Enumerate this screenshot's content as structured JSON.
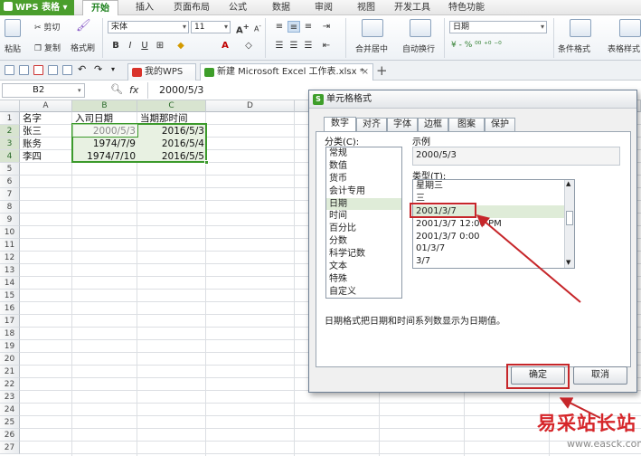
{
  "menu": {
    "app": "WPS 表格",
    "tabs": [
      "开始",
      "插入",
      "页面布局",
      "公式",
      "数据",
      "审阅",
      "视图",
      "开发工具",
      "特色功能"
    ]
  },
  "ribbon": {
    "paste": "粘贴",
    "cut": "剪切",
    "copy": "复制",
    "format_painter": "格式刷",
    "font": "宋体",
    "size": "11",
    "bold": "B",
    "italic": "I",
    "underline": "U",
    "merge": "合并居中",
    "wrap": "自动换行",
    "number_format": "日期",
    "cond_format": "条件格式",
    "table_format": "表格样式",
    "font_color_letter": "A"
  },
  "doc_tabs": [
    "我的WPS",
    "新建 Microsoft Excel 工作表.xlsx *"
  ],
  "formula": {
    "cell": "B2",
    "fx": "fx",
    "value": "2000/5/3"
  },
  "columns": [
    "A",
    "B",
    "C",
    "D"
  ],
  "rows": [
    "1",
    "2",
    "3",
    "4",
    "5",
    "6",
    "7",
    "8",
    "9",
    "10",
    "11",
    "12",
    "13",
    "14",
    "15",
    "16",
    "17",
    "18",
    "19",
    "20",
    "21",
    "22",
    "23",
    "24",
    "25",
    "26",
    "27"
  ],
  "sheet": [
    [
      "名字",
      "入司日期",
      "当期那时间"
    ],
    [
      "张三",
      "2000/5/3",
      "2016/5/3"
    ],
    [
      "账务",
      "1974/7/9",
      "2016/5/4"
    ],
    [
      "李四",
      "1974/7/10",
      "2016/5/5"
    ]
  ],
  "dialog": {
    "title": "单元格格式",
    "tabs": [
      "数字",
      "对齐",
      "字体",
      "边框",
      "图案",
      "保护"
    ],
    "category_label": "分类(C):",
    "categories": [
      "常规",
      "数值",
      "货币",
      "会计专用",
      "日期",
      "时间",
      "百分比",
      "分数",
      "科学记数",
      "文本",
      "特殊",
      "自定义"
    ],
    "sample_label": "示例",
    "sample_value": "2000/5/3",
    "type_label": "类型(T):",
    "types": [
      "星期三",
      "三",
      "2001/3/7",
      "2001/3/7 12:00 PM",
      "2001/3/7 0:00",
      "01/3/7",
      "3/7"
    ],
    "description": "日期格式把日期和时间系列数显示为日期值。",
    "ok": "确定",
    "cancel": "取消"
  },
  "watermark": {
    "text": "易采站长站",
    "url": "www.easck.com"
  }
}
